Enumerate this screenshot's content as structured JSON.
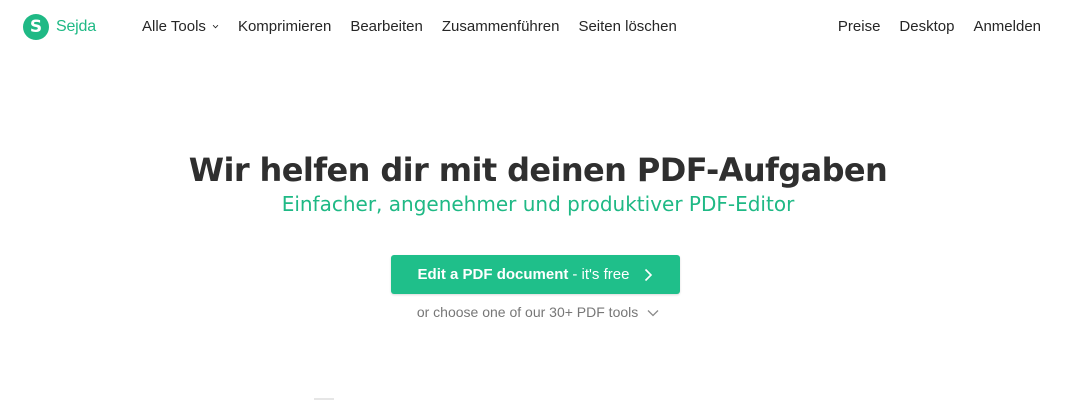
{
  "brand": {
    "logo_letter": "S",
    "name": "Sejda",
    "accent_color": "#1fb985"
  },
  "nav": {
    "main": [
      {
        "label": "Alle Tools",
        "icon": "chevron-down-icon"
      },
      {
        "label": "Komprimieren"
      },
      {
        "label": "Bearbeiten"
      },
      {
        "label": "Zusammenführen"
      },
      {
        "label": "Seiten löschen"
      }
    ],
    "right": [
      {
        "label": "Preise"
      },
      {
        "label": "Desktop"
      },
      {
        "label": "Anmelden"
      }
    ]
  },
  "hero": {
    "title": "Wir helfen dir mit deinen PDF-Aufgaben",
    "subtitle": "Einfacher, angenehmer und produktiver PDF-Editor"
  },
  "cta": {
    "label_bold": "Edit a PDF document",
    "label_light": "- it's free",
    "icon": "chevron-right-icon",
    "color": "#1fbf8a"
  },
  "tools_link": {
    "label": "or choose one of our 30+ PDF tools",
    "icon": "chevron-down-icon"
  }
}
